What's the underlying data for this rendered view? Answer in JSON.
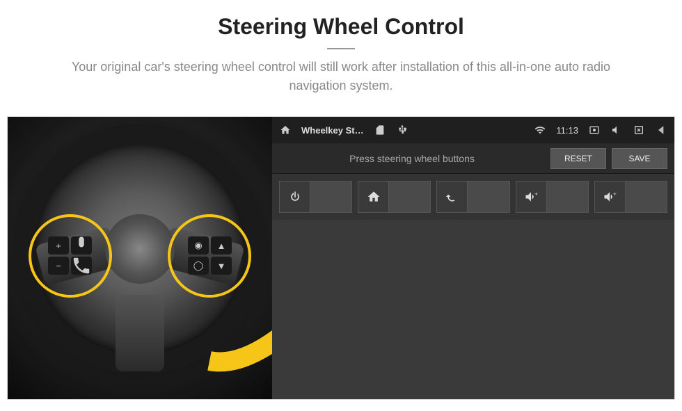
{
  "header": {
    "title": "Steering Wheel Control",
    "subtitle": "Your original car's steering wheel control will still work after installation of this all-in-one auto radio navigation system."
  },
  "statusbar": {
    "app_label": "Wheelkey St…",
    "time": "11:13"
  },
  "promptbar": {
    "prompt": "Press steering wheel buttons",
    "reset_label": "RESET",
    "save_label": "SAVE"
  },
  "slots": [
    {
      "icon": "power-icon"
    },
    {
      "icon": "home-icon"
    },
    {
      "icon": "return-icon"
    },
    {
      "icon": "volume-up-icon"
    },
    {
      "icon": "volume-up-icon"
    }
  ],
  "wheel_buttons": {
    "left": [
      "+",
      "voice",
      "−",
      "phone"
    ],
    "right": [
      "media",
      "up",
      "cycle",
      "down"
    ]
  },
  "colors": {
    "accent": "#f5c518",
    "bg_dark": "#3a3a3a",
    "bg_darker": "#2a2a2a"
  }
}
